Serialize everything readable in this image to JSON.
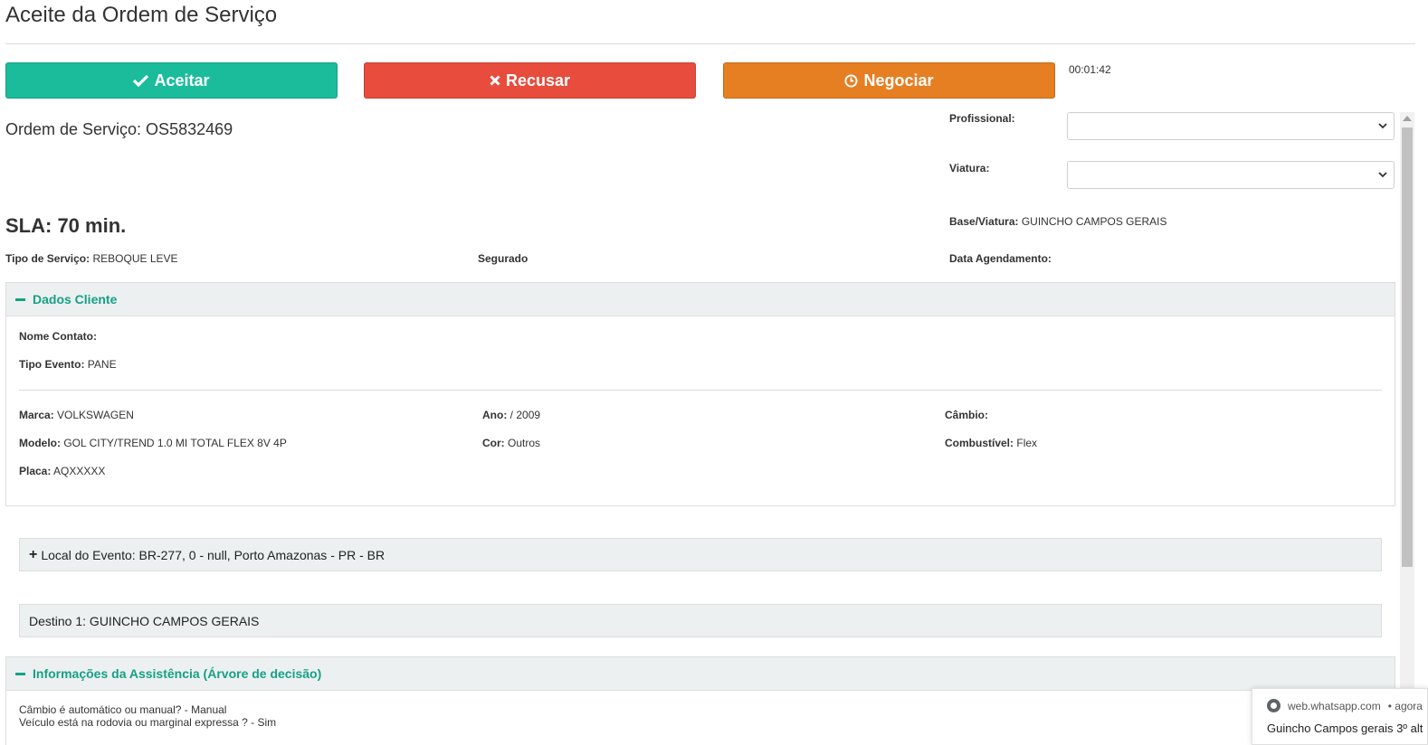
{
  "page": {
    "title": "Aceite da Ordem de Serviço"
  },
  "actions": {
    "accept_label": "Aceitar",
    "refuse_label": "Recusar",
    "negotiate_label": "Negociar",
    "timer": "00:01:42"
  },
  "colors": {
    "accept": "#1abc9c",
    "refuse": "#e74c3c",
    "negotiate": "#e67e22",
    "section_accent": "#16a085"
  },
  "order": {
    "number_text": "Ordem de Serviço: OS5832469",
    "sla_text": "SLA: 70 min.",
    "service_type_label": "Tipo de Serviço:",
    "service_type_value": "REBOQUE LEVE",
    "insured_label": "Segurado",
    "schedule_label": "Data Agendamento:",
    "schedule_value": ""
  },
  "assignment": {
    "professional_label": "Profissional:",
    "professional_value": "",
    "vehicle_label": "Viatura:",
    "vehicle_value": "",
    "base_label": "Base/Viatura:",
    "base_value": "GUINCHO CAMPOS GERAIS"
  },
  "client": {
    "section_title": "Dados Cliente",
    "contact_label": "Nome Contato:",
    "contact_value": "",
    "event_label": "Tipo Evento:",
    "event_value": "PANE",
    "brand_label": "Marca:",
    "brand_value": "VOLKSWAGEN",
    "year_label": "Ano:",
    "year_value": "/ 2009",
    "gearbox_label": "Câmbio:",
    "gearbox_value": "",
    "model_label": "Modelo:",
    "model_value": "GOL CITY/TREND 1.0 MI TOTAL FLEX 8V 4P",
    "color_label": "Cor:",
    "color_value": "Outros",
    "fuel_label": "Combustível:",
    "fuel_value": "Flex",
    "plate_label": "Placa:",
    "plate_value": "AQXXXXX"
  },
  "location": {
    "event_text": "Local do Evento: BR-277, 0 - null, Porto Amazonas - PR - BR",
    "destination_text": "Destino 1: GUINCHO CAMPOS GERAIS"
  },
  "assistance": {
    "section_title": "Informações da Assistência (Árvore de decisão)",
    "lines": [
      "Câmbio é automático ou manual? - Manual",
      "Veículo está na rodovia ou marginal expressa ? - Sim"
    ]
  },
  "notification": {
    "source": "web.whatsapp.com",
    "time": "• agora",
    "message": "Guincho Campos gerais 3º alt"
  }
}
